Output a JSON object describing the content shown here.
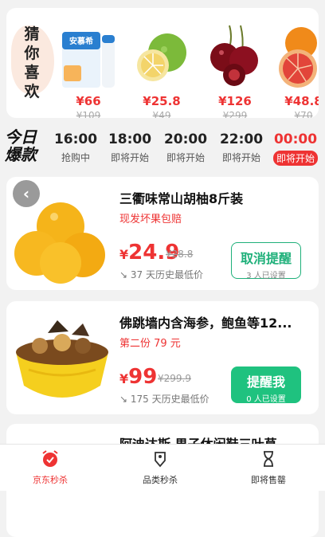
{
  "guess": {
    "label": "猜你喜欢",
    "items": [
      {
        "price": "¥66",
        "orig": "¥109",
        "brand_text": "安慕希",
        "icon": "yogurt-box"
      },
      {
        "price": "¥25.8",
        "orig": "¥49",
        "icon": "citrus"
      },
      {
        "price": "¥126",
        "orig": "¥299",
        "icon": "cherries"
      },
      {
        "price": "¥48.8",
        "orig": "¥70",
        "icon": "blood-orange"
      }
    ]
  },
  "timebar": {
    "logo_line1": "今日",
    "logo_line2": "爆款",
    "slots": [
      {
        "time": "16:00",
        "status": "抢购中"
      },
      {
        "time": "18:00",
        "status": "即将开始"
      },
      {
        "time": "20:00",
        "status": "即将开始"
      },
      {
        "time": "22:00",
        "status": "即将开始"
      },
      {
        "time": "00:00",
        "status": "即将开始"
      }
    ]
  },
  "products": [
    {
      "title": "三衢味常山胡柚8斤装",
      "subtitle": "现发坏果包赔",
      "price_yen": "¥",
      "price_value": "24.9",
      "orig_price": "¥28.8",
      "history": "37 天历史最低价",
      "button_main": "取消提醒",
      "button_sub": "3 人已设置",
      "icon": "pomelo-fruit"
    },
    {
      "title": "佛跳墙内含海参，鲍鱼等12...",
      "subtitle": "第二份 79 元",
      "price_yen": "¥",
      "price_value": "99",
      "orig_price": "¥299.9",
      "history": "175 天历史最低价",
      "button_main": "提醒我",
      "button_sub": "0 人已设置",
      "icon": "soup-bowl"
    },
    {
      "title": "阿迪达斯 男子休闲鞋三叶草"
    }
  ],
  "nav": {
    "items": [
      {
        "label": "京东秒杀",
        "icon": "alarm-clock-icon"
      },
      {
        "label": "品类秒杀",
        "icon": "tag-icon"
      },
      {
        "label": "即将售罄",
        "icon": "hourglass-icon"
      }
    ]
  },
  "colors": {
    "accent": "#e33333",
    "green": "#1fc27f"
  }
}
